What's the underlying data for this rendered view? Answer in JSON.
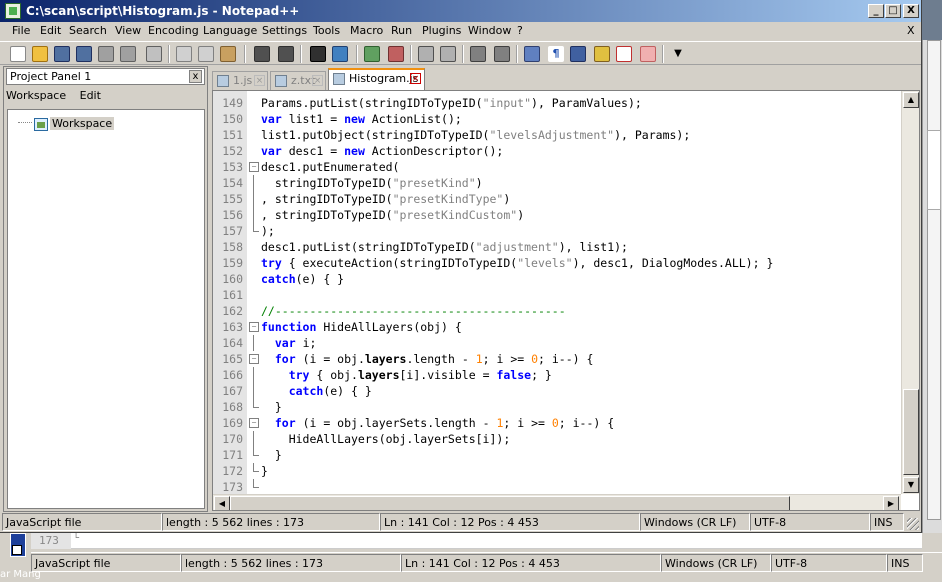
{
  "window": {
    "title": "C:\\scan\\script\\Histogram.js - Notepad++",
    "controls": {
      "minimize": "_",
      "maximize": "□",
      "close": "X"
    }
  },
  "menu": {
    "items": [
      {
        "label": "File"
      },
      {
        "label": "Edit"
      },
      {
        "label": "Search"
      },
      {
        "label": "View"
      },
      {
        "label": "Encoding"
      },
      {
        "label": "Language"
      },
      {
        "label": "Settings"
      },
      {
        "label": "Tools"
      },
      {
        "label": "Macro"
      },
      {
        "label": "Run"
      },
      {
        "label": "Plugins"
      },
      {
        "label": "Window"
      },
      {
        "label": "?"
      }
    ],
    "close_doc": "X"
  },
  "toolbar": {
    "icons": [
      "new-icon",
      "open-icon",
      "save-icon",
      "save-all-icon",
      "close-icon",
      "close-all-icon",
      "print-icon",
      "cut-icon",
      "copy-icon",
      "paste-icon",
      "undo-icon",
      "redo-icon",
      "find-icon",
      "replace-icon",
      "zoom-in-icon",
      "zoom-out-icon",
      "sync-v-icon",
      "sync-h-icon",
      "word-wrap-icon",
      "all-chars-icon",
      "indent-guide-icon",
      "user-lang-icon",
      "doc-map-icon",
      "function-list-icon",
      "folder-workspace-icon",
      "monitor-icon",
      "more-icon"
    ]
  },
  "project_panel": {
    "title": "Project Panel 1",
    "close": "x",
    "menu": [
      "Workspace",
      "Edit"
    ],
    "tree": [
      {
        "label": "Workspace"
      }
    ]
  },
  "tabs": [
    {
      "label": "1.js",
      "active": false
    },
    {
      "label": "z.txt",
      "active": false
    },
    {
      "label": "Histogram.js",
      "active": true
    }
  ],
  "editor": {
    "lines": [
      {
        "n": "149",
        "fold": "",
        "code": [
          [
            "cl",
            "Params.putList(stringIDToTypeID("
          ],
          [
            "str",
            "\"input\""
          ],
          [
            "cl",
            "), ParamValues);"
          ]
        ]
      },
      {
        "n": "150",
        "fold": "",
        "code": [
          [
            "kw",
            "var"
          ],
          [
            "cl",
            " list1 = "
          ],
          [
            "kw",
            "new"
          ],
          [
            "cl",
            " ActionList();"
          ]
        ]
      },
      {
        "n": "151",
        "fold": "",
        "code": [
          [
            "cl",
            "list1.putObject(stringIDToTypeID("
          ],
          [
            "str",
            "\"levelsAdjustment\""
          ],
          [
            "cl",
            "), Params);"
          ]
        ]
      },
      {
        "n": "152",
        "fold": "",
        "code": [
          [
            "kw",
            "var"
          ],
          [
            "cl",
            " desc1 = "
          ],
          [
            "kw",
            "new"
          ],
          [
            "cl",
            " ActionDescriptor();"
          ]
        ]
      },
      {
        "n": "153",
        "fold": "box",
        "code": [
          [
            "cl",
            "desc1.putEnumerated("
          ]
        ]
      },
      {
        "n": "154",
        "fold": "vl",
        "code": [
          [
            "cl",
            "  stringIDToTypeID("
          ],
          [
            "str",
            "\"presetKind\""
          ],
          [
            "cl",
            ")"
          ]
        ]
      },
      {
        "n": "155",
        "fold": "vl",
        "code": [
          [
            "cl",
            ", stringIDToTypeID("
          ],
          [
            "str",
            "\"presetKindType\""
          ],
          [
            "cl",
            ")"
          ]
        ]
      },
      {
        "n": "156",
        "fold": "vl",
        "code": [
          [
            "cl",
            ", stringIDToTypeID("
          ],
          [
            "str",
            "\"presetKindCustom\""
          ],
          [
            "cl",
            ")"
          ]
        ]
      },
      {
        "n": "157",
        "fold": "end",
        "code": [
          [
            "cl",
            ");"
          ]
        ]
      },
      {
        "n": "158",
        "fold": "",
        "code": [
          [
            "cl",
            "desc1.putList(stringIDToTypeID("
          ],
          [
            "str",
            "\"adjustment\""
          ],
          [
            "cl",
            "), list1);"
          ]
        ]
      },
      {
        "n": "159",
        "fold": "",
        "code": [
          [
            "kw",
            "try"
          ],
          [
            "cl",
            " { executeAction(stringIDToTypeID("
          ],
          [
            "str",
            "\"levels\""
          ],
          [
            "cl",
            "), desc1, DialogModes.ALL); }"
          ]
        ]
      },
      {
        "n": "160",
        "fold": "",
        "code": [
          [
            "kw",
            "catch"
          ],
          [
            "cl",
            "(e) { }"
          ]
        ]
      },
      {
        "n": "161",
        "fold": "",
        "code": [
          [
            "cl",
            ""
          ]
        ]
      },
      {
        "n": "162",
        "fold": "",
        "code": [
          [
            "cm",
            "//------------------------------------------"
          ]
        ]
      },
      {
        "n": "163",
        "fold": "box",
        "code": [
          [
            "kw",
            "function"
          ],
          [
            "cl",
            " HideAllLayers(obj) {"
          ]
        ]
      },
      {
        "n": "164",
        "fold": "vl",
        "code": [
          [
            "cl",
            "  "
          ],
          [
            "kw",
            "var"
          ],
          [
            "cl",
            " i;"
          ]
        ]
      },
      {
        "n": "165",
        "fold": "box",
        "code": [
          [
            "cl",
            "  "
          ],
          [
            "kw",
            "for"
          ],
          [
            "cl",
            " (i = obj."
          ],
          [
            "pr",
            "layers"
          ],
          [
            "cl",
            ".length - "
          ],
          [
            "nm",
            "1"
          ],
          [
            "cl",
            "; i >= "
          ],
          [
            "nm",
            "0"
          ],
          [
            "cl",
            "; i--) {"
          ]
        ]
      },
      {
        "n": "166",
        "fold": "vl",
        "code": [
          [
            "cl",
            "    "
          ],
          [
            "kw",
            "try"
          ],
          [
            "cl",
            " { obj."
          ],
          [
            "pr",
            "layers"
          ],
          [
            "cl",
            "[i].visible = "
          ],
          [
            "kw",
            "false"
          ],
          [
            "cl",
            "; }"
          ]
        ]
      },
      {
        "n": "167",
        "fold": "vl",
        "code": [
          [
            "cl",
            "    "
          ],
          [
            "kw",
            "catch"
          ],
          [
            "cl",
            "(e) { }"
          ]
        ]
      },
      {
        "n": "168",
        "fold": "end",
        "code": [
          [
            "cl",
            "  }"
          ]
        ]
      },
      {
        "n": "169",
        "fold": "box",
        "code": [
          [
            "cl",
            "  "
          ],
          [
            "kw",
            "for"
          ],
          [
            "cl",
            " (i = obj.layerSets.length - "
          ],
          [
            "nm",
            "1"
          ],
          [
            "cl",
            "; i >= "
          ],
          [
            "nm",
            "0"
          ],
          [
            "cl",
            "; i--) {"
          ]
        ]
      },
      {
        "n": "170",
        "fold": "vl",
        "code": [
          [
            "cl",
            "    HideAllLayers(obj.layerSets[i]);"
          ]
        ]
      },
      {
        "n": "171",
        "fold": "end",
        "code": [
          [
            "cl",
            "  }"
          ]
        ]
      },
      {
        "n": "172",
        "fold": "end",
        "code": [
          [
            "cl",
            "}"
          ]
        ]
      },
      {
        "n": "173",
        "fold": "end",
        "code": [
          [
            "cl",
            ""
          ]
        ]
      }
    ]
  },
  "status": {
    "type": "JavaScript file",
    "length": "length : 5 562    lines : 173",
    "pos": "Ln : 141    Col : 12    Pos : 4 453",
    "eol": "Windows (CR LF)",
    "encoding": "UTF-8",
    "mode": "INS"
  },
  "background_window": {
    "gutter_line": "173",
    "status": {
      "type": "JavaScript file",
      "length": "length : 5 562    lines : 173",
      "pos": "Ln : 141    Col : 12    Pos : 4 453",
      "eol": "Windows (CR LF)",
      "encoding": "UTF-8",
      "mode": "INS"
    },
    "desktop_label": "ar Mang"
  }
}
